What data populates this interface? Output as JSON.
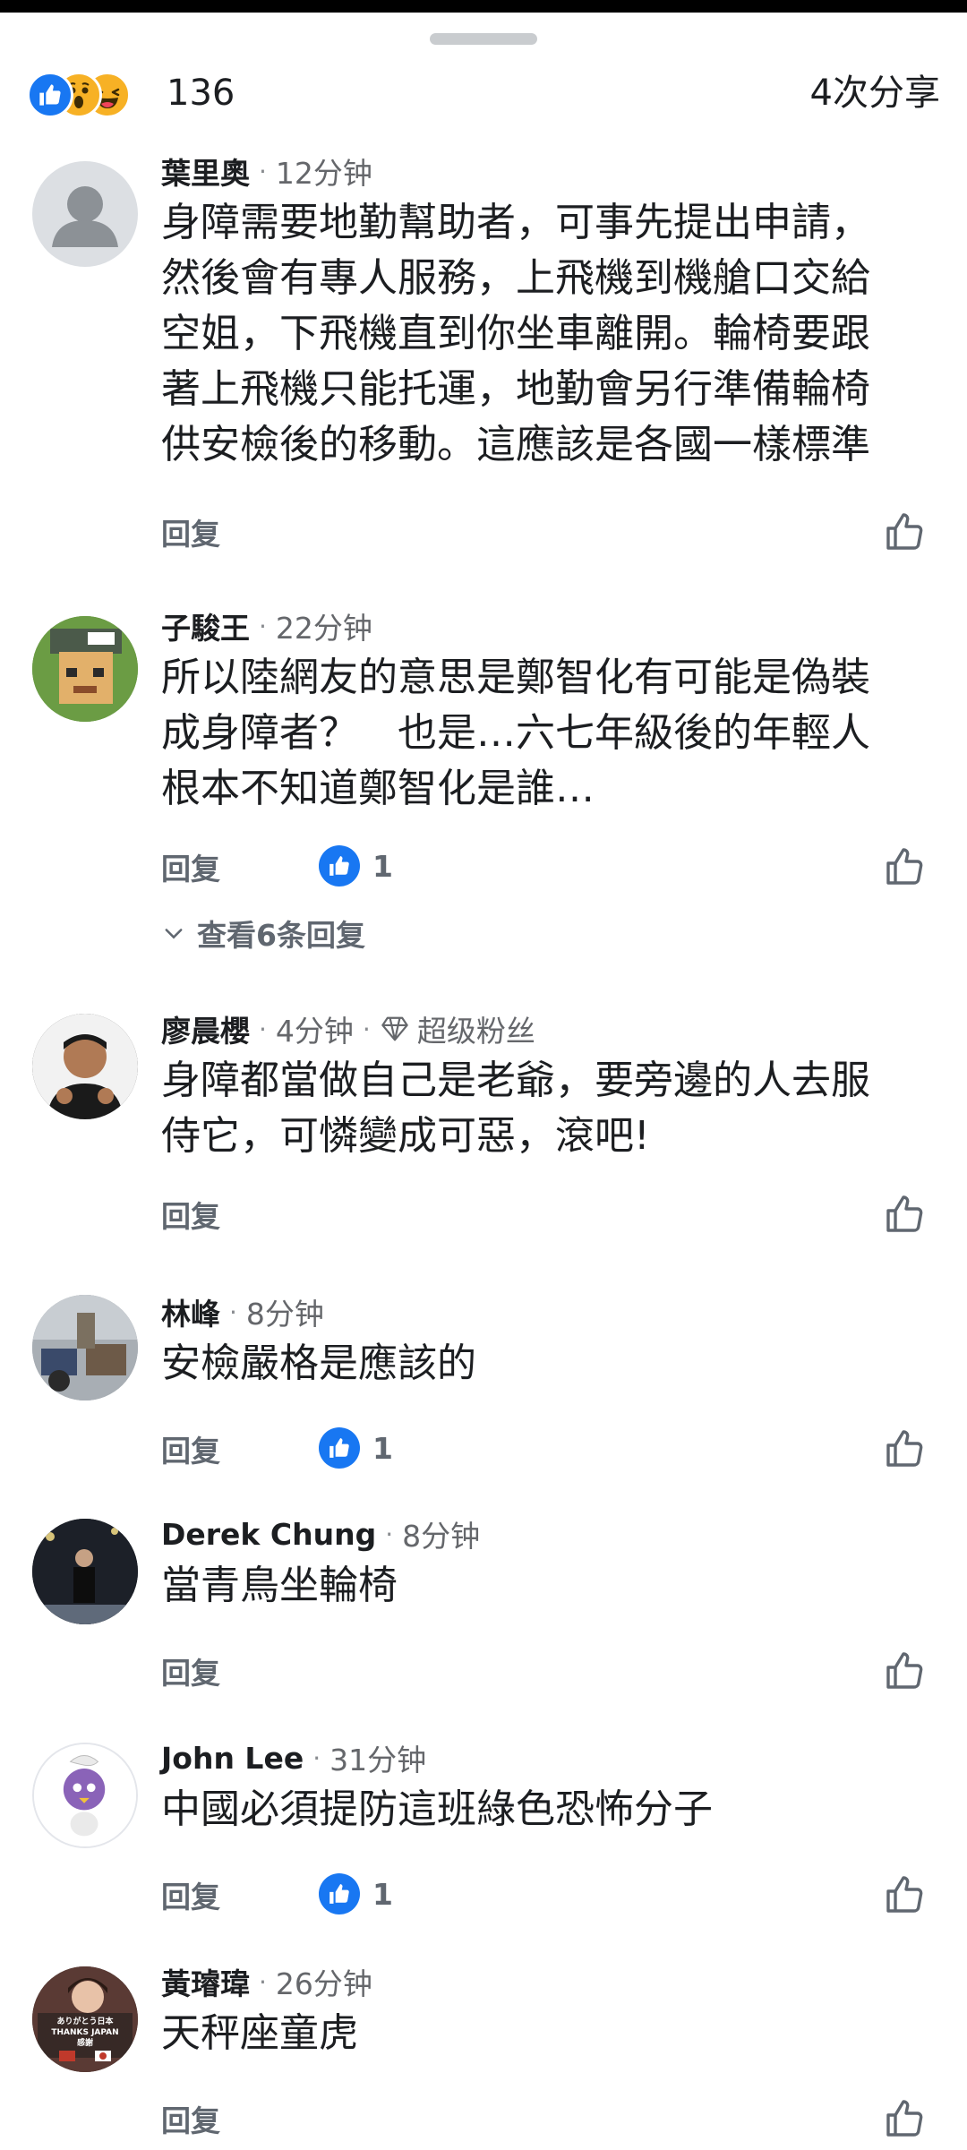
{
  "reactions": {
    "icons": [
      "like-icon",
      "wow-icon",
      "haha-icon"
    ],
    "count": "136",
    "shares": "4次分享"
  },
  "labels": {
    "reply": "回复",
    "view_replies": "查看6条回复"
  },
  "comments": [
    {
      "author": "葉里奧",
      "time": "12分钟",
      "lines": [
        "身障需要地勤幫助者，可事先提出申請，",
        "然後會有專人服務，上飛機到機艙口交給",
        "空姐，下飛機直到你坐車離開。輪椅要跟",
        "著上飛機只能托運，地勤會另行準備輪椅",
        "供安檢後的移動。這應該是各國一樣標準"
      ]
    },
    {
      "author": "子駿王",
      "time": "22分钟",
      "lines": [
        "所以陸網友的意思是鄭智化有可能是偽裝",
        "成身障者？　也是…六七年級後的年輕人",
        "根本不知道鄭智化是誰…"
      ],
      "likes": "1"
    },
    {
      "author": "廖晨櫻",
      "time": "4分钟",
      "badge": "超级粉丝",
      "lines": [
        "身障都當做自己是老爺，要旁邊的人去服",
        "侍它，可憐變成可惡，滾吧!"
      ]
    },
    {
      "author": "林峰",
      "time": "8分钟",
      "lines": [
        "安檢嚴格是應該的"
      ],
      "likes": "1"
    },
    {
      "author": "Derek Chung",
      "time": "8分钟",
      "lines": [
        "當青鳥坐輪椅"
      ]
    },
    {
      "author": "John Lee",
      "time": "31分钟",
      "lines": [
        "中國必須提防這班綠色恐怖分子"
      ],
      "likes": "1"
    },
    {
      "author": "黃璿瑋",
      "time": "26分钟",
      "lines": [
        "天秤座童虎"
      ],
      "avatar_text": [
        "ありがとう日本",
        "THANKS JAPAN",
        "感謝"
      ]
    }
  ]
}
